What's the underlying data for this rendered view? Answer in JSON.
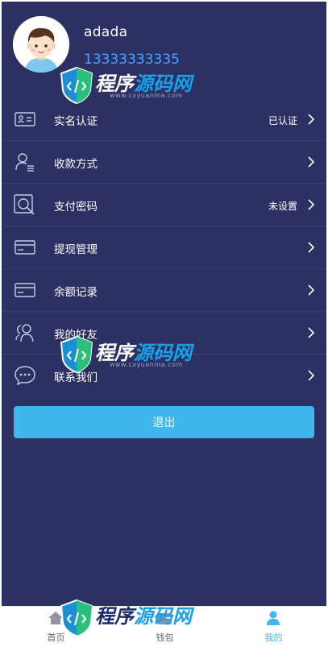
{
  "user": {
    "name": "adada",
    "phone": "13333333335"
  },
  "menu": [
    {
      "label": "实名认证",
      "status": "已认证",
      "icon": "id-card-icon"
    },
    {
      "label": "收款方式",
      "status": "",
      "icon": "user-list-icon"
    },
    {
      "label": "支付密码",
      "status": "未设置",
      "icon": "search-lock-icon"
    },
    {
      "label": "提现管理",
      "status": "",
      "icon": "card-icon"
    },
    {
      "label": "余额记录",
      "status": "",
      "icon": "card-icon"
    },
    {
      "label": "我的好友",
      "status": "",
      "icon": "friends-icon"
    },
    {
      "label": "联系我们",
      "status": "",
      "icon": "chat-icon"
    }
  ],
  "logout_label": "退出",
  "tabs": [
    {
      "label": "首页",
      "icon": "home-icon",
      "active": false
    },
    {
      "label": "钱包",
      "icon": "wallet-icon",
      "active": false
    },
    {
      "label": "我的",
      "icon": "person-icon",
      "active": true
    }
  ],
  "watermark": {
    "text_a": "程序",
    "text_b": "源码网",
    "url": "www.cxyuanma.com"
  },
  "colors": {
    "background": "#2d3062",
    "accent": "#3fb6ec",
    "phone": "#46a6ff"
  }
}
